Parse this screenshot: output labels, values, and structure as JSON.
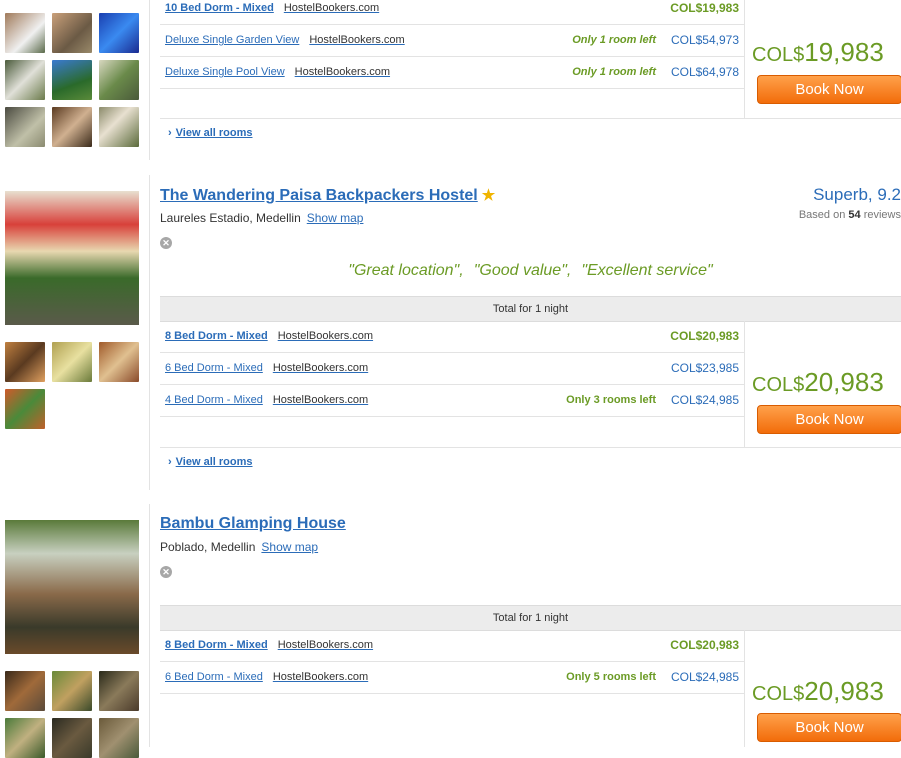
{
  "listings": [
    {
      "rooms": [
        {
          "name": "10 Bed Dorm - Mixed",
          "site": "HostelBookers.com",
          "availability": "",
          "price": "COL$19,983",
          "best": true
        },
        {
          "name": "Deluxe Single Garden View",
          "site": "HostelBookers.com",
          "availability": "Only 1 room left",
          "price": "COL$54,973",
          "best": false
        },
        {
          "name": "Deluxe Single Pool View",
          "site": "HostelBookers.com",
          "availability": "Only 1 room left",
          "price": "COL$64,978",
          "best": false
        }
      ],
      "price_currency": "COL$",
      "price_amount": "19,983",
      "book_label": "Book Now",
      "view_all_label": "View all rooms",
      "photo_colors": [
        "#8c6e55",
        "#7b6b58",
        "#2a5bc4",
        "#6b7a4f",
        "#3d6fae",
        "#7a8a4f",
        "#756245",
        "#5c4a38",
        "#8b7a62"
      ]
    },
    {
      "name": "The Wandering Paisa Backpackers Hostel",
      "location": "Laureles Estadio, Medellin",
      "show_map_label": "Show map",
      "rating": "Superb, 9.2",
      "reviews_prefix": "Based on",
      "reviews_count": "54",
      "reviews_suffix": "reviews",
      "quotes": [
        "\"Great location\",",
        "\"Good value\",",
        "\"Excellent service\""
      ],
      "total_label": "Total for 1 night",
      "rooms": [
        {
          "name": "8 Bed Dorm - Mixed",
          "site": "HostelBookers.com",
          "availability": "",
          "price": "COL$20,983",
          "best": true
        },
        {
          "name": "6 Bed Dorm - Mixed",
          "site": "HostelBookers.com",
          "availability": "",
          "price": "COL$23,985",
          "best": false
        },
        {
          "name": "4 Bed Dorm - Mixed",
          "site": "HostelBookers.com",
          "availability": "Only 3 rooms left",
          "price": "COL$24,985",
          "best": false
        }
      ],
      "price_currency": "COL$",
      "price_amount": "20,983",
      "book_label": "Book Now",
      "view_all_label": "View all rooms",
      "photo_colors": [
        "#a0673a",
        "#8a8a3a",
        "#9a5a2a",
        "#b0552a"
      ]
    },
    {
      "name": "Bambu Glamping House",
      "location": "Poblado, Medellin",
      "show_map_label": "Show map",
      "total_label": "Total for 1 night",
      "rooms": [
        {
          "name": "8 Bed Dorm - Mixed",
          "site": "HostelBookers.com",
          "availability": "",
          "price": "COL$20,983",
          "best": true
        },
        {
          "name": "6 Bed Dorm - Mixed",
          "site": "HostelBookers.com",
          "availability": "Only 5 rooms left",
          "price": "COL$24,985",
          "best": false
        }
      ],
      "price_currency": "COL$",
      "price_amount": "20,983",
      "book_label": "Book Now",
      "photo_colors": [
        "#6b4a2c",
        "#5a6a3a",
        "#4a3a28",
        "#5a7a3a",
        "#3a3a2a",
        "#6a5a3a"
      ]
    }
  ]
}
